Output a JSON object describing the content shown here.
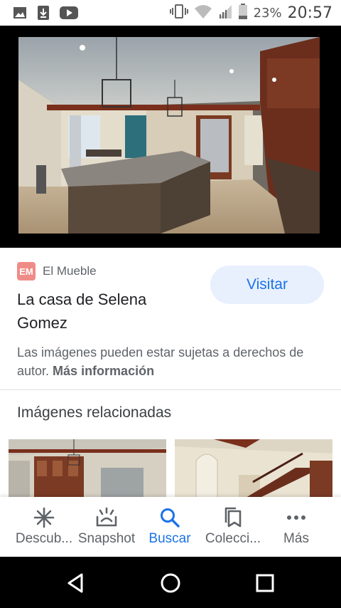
{
  "status_bar": {
    "icons_left": [
      "gallery-icon",
      "download-icon",
      "youtube-icon"
    ],
    "icons_right": [
      "vibrate-icon",
      "wifi-icon",
      "signal-icon",
      "battery-icon"
    ],
    "battery": "23%",
    "time": "20:57"
  },
  "image": {
    "subject": "kitchen-photo"
  },
  "source": {
    "logo_text": "EM",
    "name": "El Mueble",
    "logo_color": "#f08c87"
  },
  "title": "La casa de Selena Gomez",
  "visit_button": "Visitar",
  "copyright": {
    "text": "Las imágenes pueden estar sujetas a derechos de autor. ",
    "link": "Más información"
  },
  "related": {
    "heading": "Imágenes relacionadas"
  },
  "bottom_nav": {
    "items": [
      {
        "label": "Descub...",
        "icon": "asterisk-icon"
      },
      {
        "label": "Snapshot",
        "icon": "snapshot-icon"
      },
      {
        "label": "Buscar",
        "icon": "search-icon"
      },
      {
        "label": "Colecci...",
        "icon": "collections-icon"
      },
      {
        "label": "Más",
        "icon": "more-dots-icon"
      }
    ],
    "active_index": 2,
    "active_color": "#1a73e8"
  },
  "system_nav": [
    "back-icon",
    "home-icon",
    "recents-icon"
  ]
}
